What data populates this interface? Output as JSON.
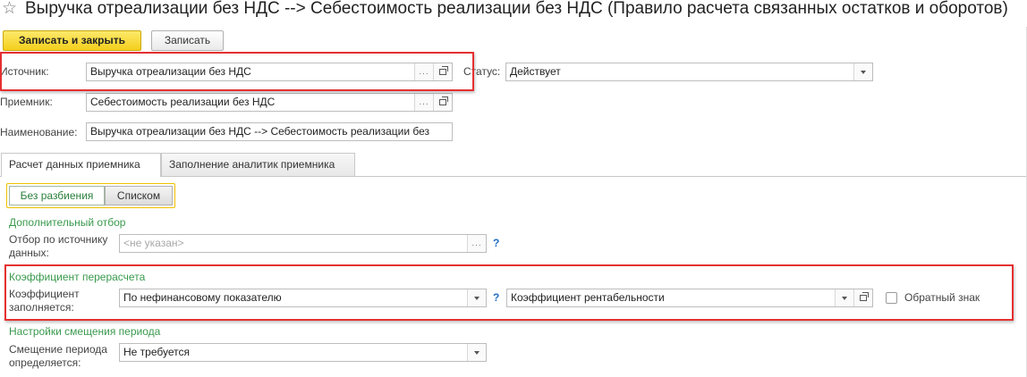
{
  "window": {
    "title_star": "☆",
    "title": "Выручка отреализации без НДС --> Себестоимость реализации без НДС (Правило расчета связанных остатков и оборотов)"
  },
  "toolbar": {
    "save_close_label": "Записать и закрыть",
    "save_label": "Записать"
  },
  "form": {
    "source_label": "Источник:",
    "source_value": "Выручка отреализации без НДС",
    "status_label": "Статус:",
    "status_value": "Действует",
    "receiver_label": "Приемник:",
    "receiver_value": "Себестоимость реализации без НДС",
    "name_label": "Наименование:",
    "name_value": "Выручка отреализации без НДС --> Себестоимость реализации без"
  },
  "tabs": [
    {
      "label": "Расчет данных приемника",
      "active": true
    },
    {
      "label": "Заполнение аналитик приемника",
      "active": false
    }
  ],
  "view_toggle": {
    "option1": "Без разбиения",
    "option2": "Списком",
    "selected": "Без разбиения"
  },
  "filter_section": {
    "title": "Дополнительный отбор",
    "label": "Отбор по источнику данных:",
    "placeholder": "<не указан>",
    "help": "?"
  },
  "coef_section": {
    "title": "Коэффициент перерасчета",
    "label": "Коэффициент заполняется:",
    "mode_value": "По нефинансовому показателю",
    "help": "?",
    "indicator_value": "Коэффициент рентабельности",
    "reverse_label": "Обратный знак",
    "reverse_checked": false
  },
  "shift_section": {
    "title": "Настройки смещения периода",
    "label": "Смещение периода определяется:",
    "value": "Не требуется"
  },
  "icons": {
    "dots": "...",
    "accent_red": "#e53030",
    "section_green": "#3a9a4e",
    "help_blue": "#1f6fc2",
    "primary_yellow": "#f4cf1c"
  }
}
